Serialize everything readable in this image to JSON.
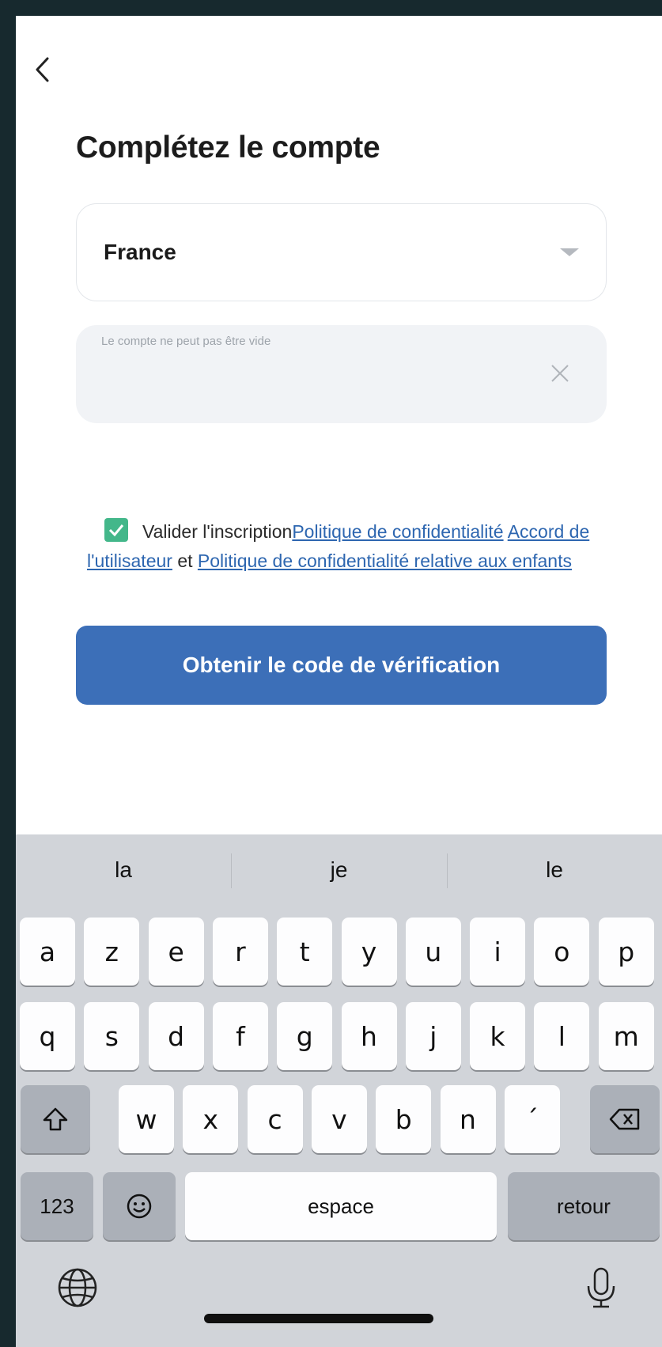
{
  "header": {
    "back_icon": "chevron-left-icon",
    "title": "Complétez le compte"
  },
  "form": {
    "country_value": "France",
    "account_hint": "Le compte ne peut pas être vide",
    "account_value": ""
  },
  "agreement": {
    "checked": true,
    "prefix": "Valider l'inscription",
    "privacy_link": "Politique de confidentialité",
    "user_agreement_link": "Accord de l'utilisateur",
    "conjunction": "et",
    "children_privacy_link": "Politique de confidentialité relative aux enfants"
  },
  "cta_label": "Obtenir le code de vérification",
  "keyboard": {
    "suggestions": [
      "la",
      "je",
      "le"
    ],
    "row1": [
      "a",
      "z",
      "e",
      "r",
      "t",
      "y",
      "u",
      "i",
      "o",
      "p"
    ],
    "row2": [
      "q",
      "s",
      "d",
      "f",
      "g",
      "h",
      "j",
      "k",
      "l",
      "m"
    ],
    "row3": [
      "w",
      "x",
      "c",
      "v",
      "b",
      "n",
      "´"
    ],
    "numbers_label": "123",
    "space_label": "espace",
    "return_label": "retour"
  },
  "colors": {
    "accent": "#3c6fb8",
    "link": "#2d66b0",
    "checkbox": "#43b78a",
    "bezel": "#17292e"
  }
}
